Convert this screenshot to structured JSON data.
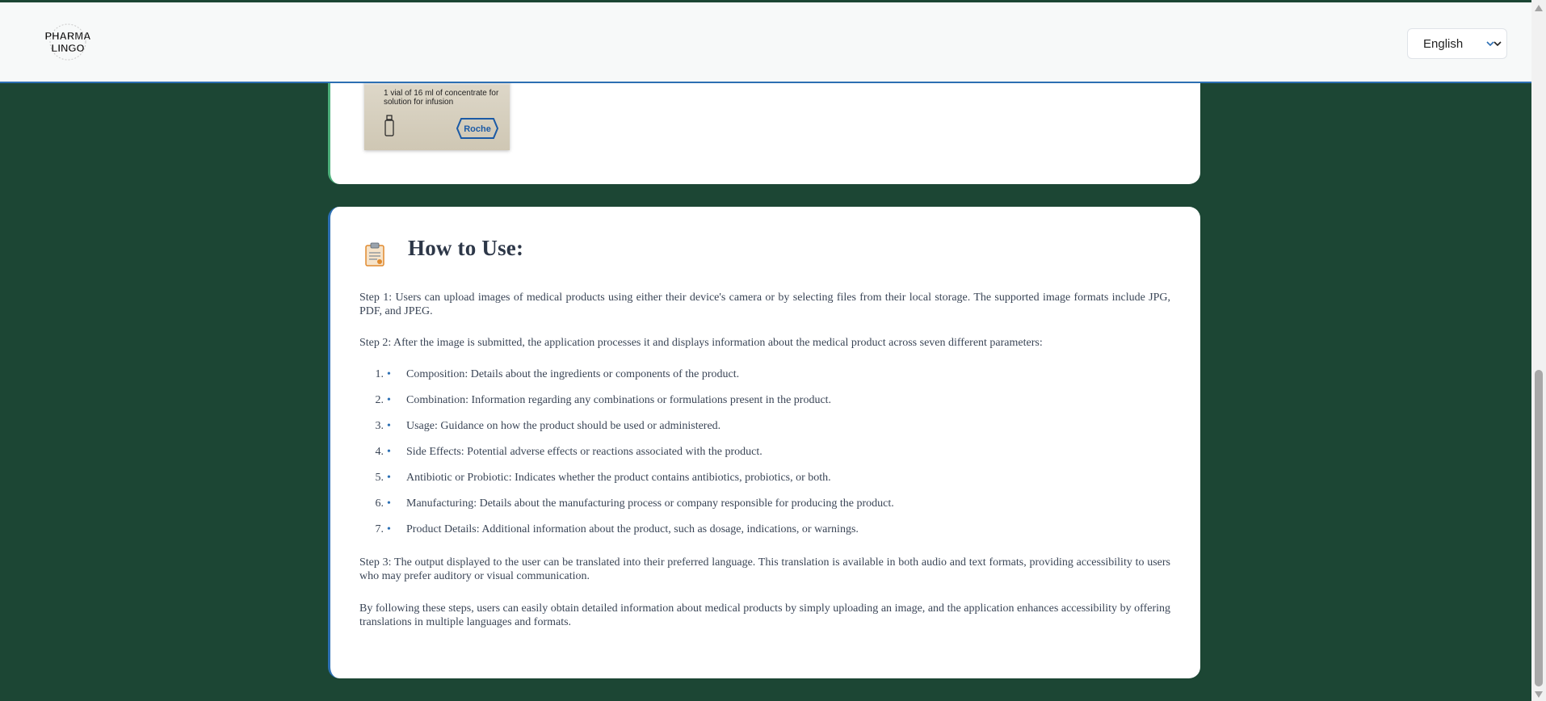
{
  "header": {
    "logo_line1": "PHARMA",
    "logo_line2": "LINGO",
    "language": "English"
  },
  "product_image": {
    "box_text": "1 vial of 16 ml of concentrate for solution for infusion",
    "brand": "Roche"
  },
  "how_to_use": {
    "title": "How to Use:",
    "step1": "Step 1: Users can upload images of medical products using either their device's camera or by selecting files from their local storage. The supported image formats include JPG, PDF, and JPEG.",
    "step2": "Step 2: After the image is submitted, the application processes it and displays information about the medical product across seven different parameters:",
    "parameters": [
      {
        "num": "1.",
        "text": "Composition: Details about the ingredients or components of the product."
      },
      {
        "num": "2.",
        "text": "Combination: Information regarding any combinations or formulations present in the product."
      },
      {
        "num": "3.",
        "text": "Usage: Guidance on how the product should be used or administered."
      },
      {
        "num": "4.",
        "text": "Side Effects: Potential adverse effects or reactions associated with the product."
      },
      {
        "num": "5.",
        "text": "Antibiotic or Probiotic: Indicates whether the product contains antibiotics, probiotics, or both."
      },
      {
        "num": "6.",
        "text": "Manufacturing: Details about the manufacturing process or company responsible for producing the product."
      },
      {
        "num": "7.",
        "text": "Product Details: Additional information about the product, such as dosage, indications, or warnings."
      }
    ],
    "bullet": "•",
    "step3": "Step 3: The output displayed to the user can be translated into their preferred language. This translation is available in both audio and text formats, providing accessibility to users who may prefer auditory or visual communication.",
    "closing": "By following these steps, users can easily obtain detailed information about medical products by simply uploading an image, and the application enhances accessibility by offering translations in multiple languages and formats."
  },
  "colors": {
    "page_bg": "#1c4634",
    "accent_blue": "#2c6fb3",
    "card_bg": "#ffffff"
  },
  "icons": [
    "clipboard-icon",
    "chevron-down-icon",
    "scroll-up-arrow-icon",
    "scroll-down-arrow-icon"
  ]
}
